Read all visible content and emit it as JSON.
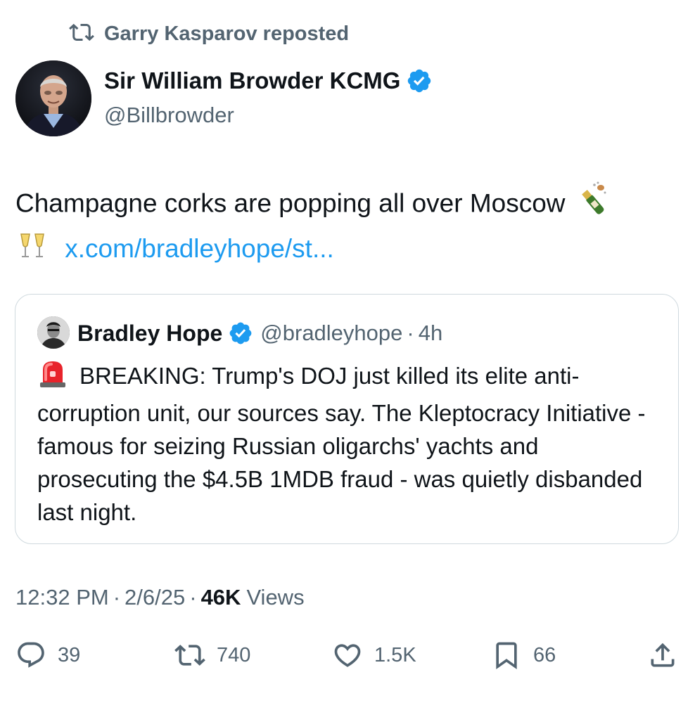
{
  "repost": {
    "label": "Garry Kasparov reposted",
    "icon": "repost-icon"
  },
  "author": {
    "name": "Sir William Browder KCMG",
    "handle": "@Billbrowder",
    "verified": true
  },
  "tweet": {
    "text": "Champagne corks are popping all over Moscow",
    "emojis": [
      "bottle-with-popping-cork",
      "clinking-glasses"
    ],
    "link": "x.com/bradleyhope/st..."
  },
  "quote": {
    "name": "Bradley Hope",
    "handle": "@bradleyhope",
    "separator": "·",
    "time": "4h",
    "emoji": "police-car-light",
    "text": "BREAKING: Trump's DOJ just killed its elite anti-corruption unit, our sources say. The Kleptocracy Initiative - famous for seizing Russian oligarchs' yachts and prosecuting the $4.5B 1MDB fraud - was quietly disbanded last night."
  },
  "meta": {
    "time": "12:32 PM",
    "date": "2/6/25",
    "separator": "·",
    "views_count": "46K",
    "views_label": "Views"
  },
  "actions": {
    "replies": "39",
    "reposts": "740",
    "likes": "1.5K",
    "bookmarks": "66"
  },
  "colors": {
    "text": "#0f1419",
    "secondary": "#536471",
    "link": "#1d9bf0",
    "verified": "#1d9bf0",
    "border": "#cfd9de"
  }
}
